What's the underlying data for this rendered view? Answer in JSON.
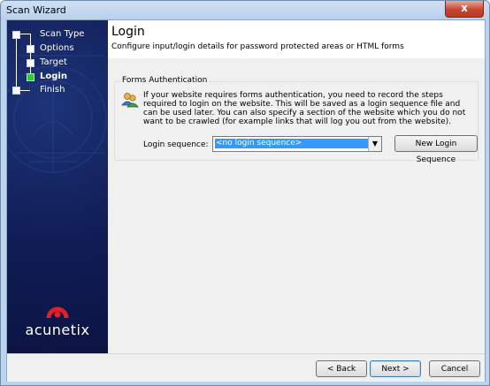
{
  "window": {
    "title": "Scan Wizard",
    "close_symbol": "x"
  },
  "sidebar": {
    "steps": [
      {
        "label": "Scan Type",
        "state": "done"
      },
      {
        "label": "Options",
        "state": "done"
      },
      {
        "label": "Target",
        "state": "done"
      },
      {
        "label": "Login",
        "state": "active"
      },
      {
        "label": "Finish",
        "state": "pending"
      }
    ],
    "brand": "acunetix",
    "active_color": "#27d13a"
  },
  "header": {
    "title": "Login",
    "subtitle": "Configure input/login details for password protected areas or HTML forms"
  },
  "forms_auth": {
    "legend": "Forms Authentication",
    "description": "If your website requires forms authentication, you need to record the steps required to login on the website. This will be saved as a login sequence file and can be used later. You can also specify a section of the website which you do not want to be crawled (for example links that will log you out from the website).",
    "login_sequence_label": "Login sequence:",
    "login_sequence_value": "<no login sequence>",
    "new_button": "New Login Sequence"
  },
  "footer": {
    "back": "< Back",
    "next": "Next >",
    "cancel": "Cancel"
  }
}
